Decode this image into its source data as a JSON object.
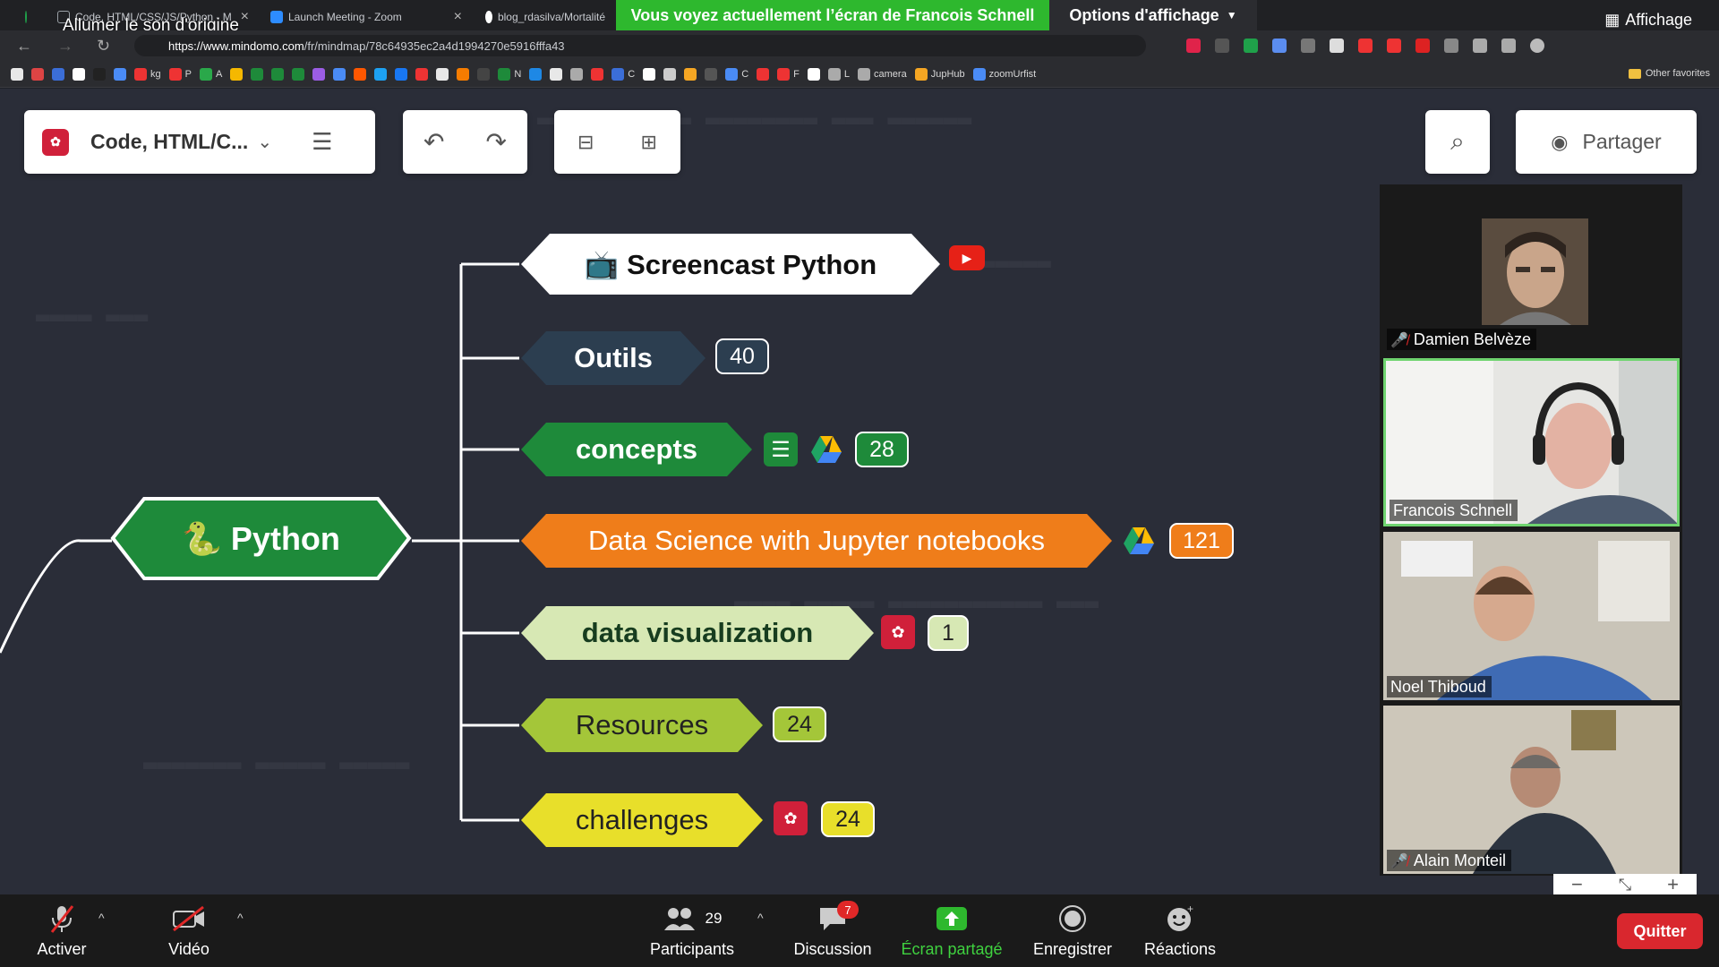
{
  "browser": {
    "tabs": [
      {
        "title": "Code, HTML/CSS/JS/Python - M",
        "favicon_color": "#9aa0a6"
      },
      {
        "title": "Launch Meeting - Zoom",
        "favicon_color": "#2d8cff"
      },
      {
        "title": "blog_rdasilva/Mortalité",
        "favicon_color": "#ffffff"
      }
    ],
    "mute_tooltip": "Allumer le son d'origine",
    "url_host": "https://www.mindomo.com",
    "url_path": "/fr/mindmap/78c64935ec2a4d1994270e5916fffa43",
    "bookmarks": [
      "",
      "",
      "",
      "",
      "",
      "",
      "kg",
      "P",
      "A",
      "",
      "",
      "",
      "",
      "",
      "",
      "",
      "",
      "",
      "",
      "",
      "",
      "",
      "N",
      "",
      "",
      "",
      "",
      "C",
      "",
      "",
      "",
      "",
      "C",
      "",
      "F",
      "",
      "L",
      "camera",
      "JupHub",
      "zoomUrfist"
    ],
    "other_favorites": "Other favorites",
    "affichage": "Affichage"
  },
  "zoom_banner": {
    "sharing_text": "Vous voyez actuellement l’écran de Francois Schnell",
    "view_options": "Options d'affichage"
  },
  "mindmap": {
    "map_title": "Code, HTML/C...",
    "share_label": "Partager",
    "central_topic": {
      "label": "Python",
      "emoji": "🐍"
    },
    "topics": [
      {
        "label": "Screencast Python",
        "emoji": "📺",
        "count": ""
      },
      {
        "label": "Outils",
        "count": "40"
      },
      {
        "label": "concepts",
        "count": "28"
      },
      {
        "label": "Data Science with Jupyter notebooks",
        "count": "121"
      },
      {
        "label": "data visualization",
        "count": "1"
      },
      {
        "label": "Resources",
        "count": "24"
      },
      {
        "label": "challenges",
        "count": "24"
      }
    ],
    "colors": {
      "outils": "#2c3e50",
      "concepts": "#1e8a3a",
      "datascience": "#ef7d1a",
      "dataviz": "#d7e8b4",
      "resources": "#a4c639",
      "challenges": "#e8df2a",
      "python": "#1e8a3a"
    }
  },
  "participants": [
    {
      "name": "Damien Belvèze",
      "muted": true
    },
    {
      "name": "Francois Schnell",
      "muted": false
    },
    {
      "name": "Noel Thiboud",
      "muted": false
    },
    {
      "name": "Alain Monteil",
      "muted": true
    }
  ],
  "zoom_toolbar": {
    "audio": "Activer",
    "video": "Vidéo",
    "participants": "Participants",
    "participants_count": "29",
    "chat": "Discussion",
    "chat_unread": "7",
    "share": "Écran partagé",
    "record": "Enregistrer",
    "reactions": "Réactions",
    "quit": "Quitter"
  }
}
